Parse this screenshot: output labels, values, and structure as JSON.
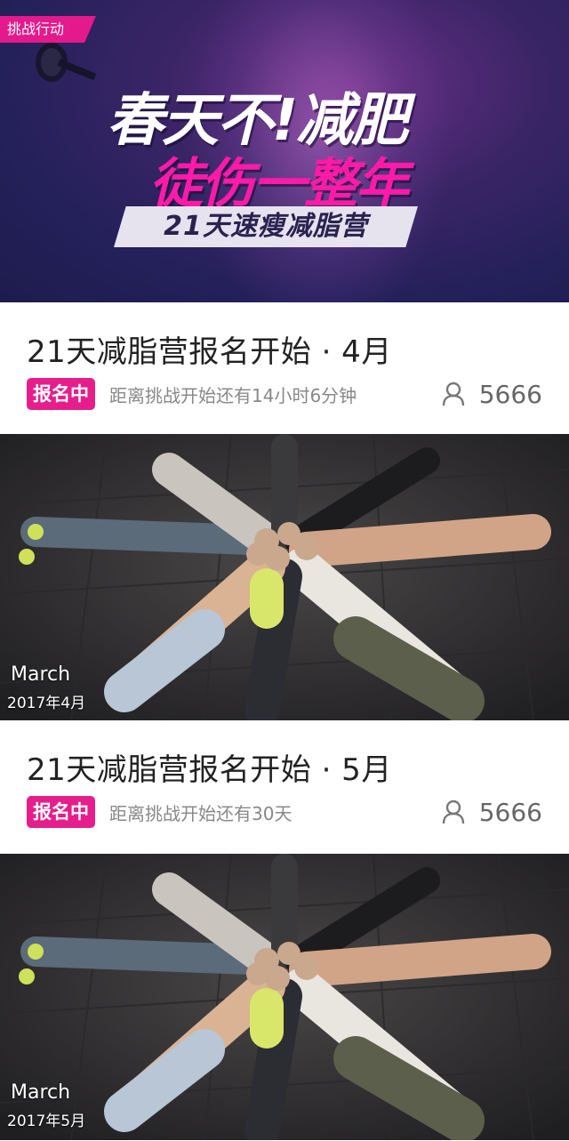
{
  "hero": {
    "tag": "挑战行动",
    "headline": "春天不!减肥",
    "subheadline": "徒伤一整年",
    "band_text": "21天速瘦减脂营",
    "accent_color": "#e3198c"
  },
  "camps": [
    {
      "title": "21天减脂营报名开始 · 4月",
      "badge": "报名中",
      "countdown": "距离挑战开始还有14小时6分钟",
      "participants_icon": "person-icon",
      "participants": "5666",
      "photo_month": "March",
      "photo_date": "2017年4月"
    },
    {
      "title": "21天减脂营报名开始 · 5月",
      "badge": "报名中",
      "countdown": "距离挑战开始还有30天",
      "participants_icon": "person-icon",
      "participants": "5666",
      "photo_month": "March",
      "photo_date": "2017年5月"
    }
  ],
  "colors": {
    "badge": "#e61e8c",
    "hero_bg": "#24205a",
    "text_primary": "#222222",
    "text_secondary": "#888888"
  }
}
